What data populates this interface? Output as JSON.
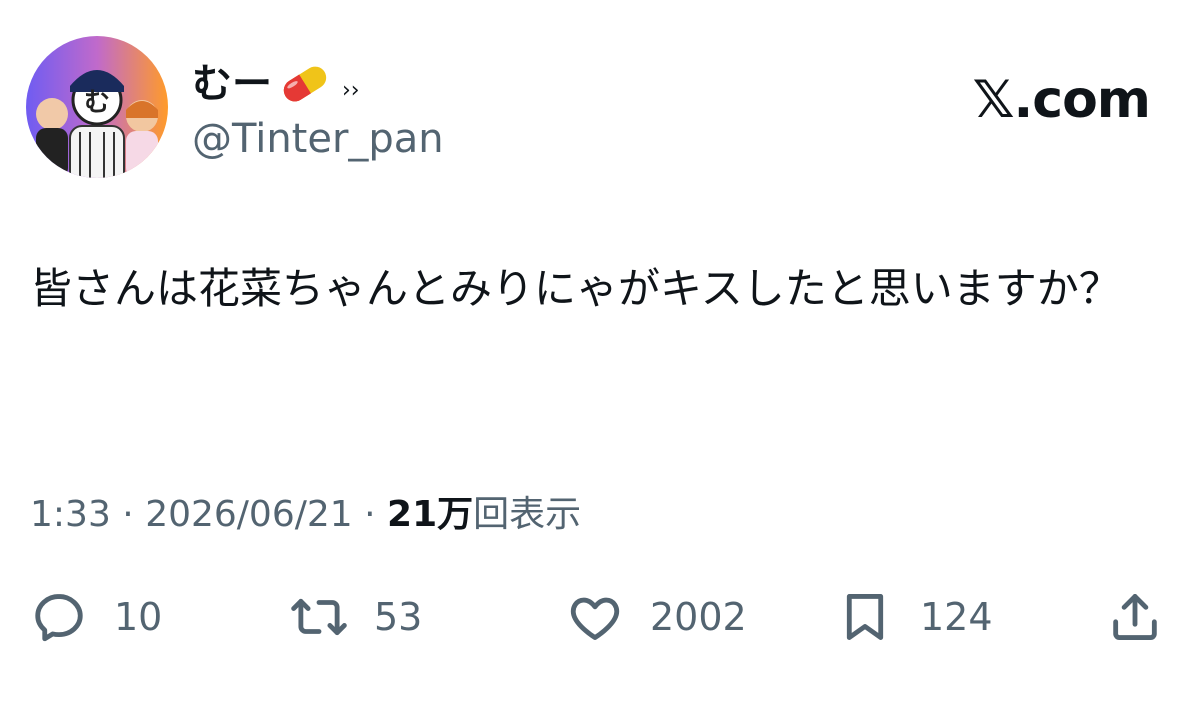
{
  "user": {
    "display_name": "むー",
    "name_suffix": "››",
    "handle": "@Tinter_pan",
    "avatar_glyph": "む"
  },
  "brand": "𝕏.com",
  "tweet": {
    "text": "皆さんは花菜ちゃんとみりにゃがキスしたと思いますか？"
  },
  "meta": {
    "time": "1:33",
    "date": "2026/06/21",
    "views_count": "21万",
    "views_label": "回表示"
  },
  "actions": {
    "replies": "10",
    "reposts": "53",
    "likes": "2002",
    "bookmarks": "124"
  },
  "colors": {
    "text": "#0f1419",
    "secondary": "#536471",
    "avatar_left": "#7b5cff",
    "avatar_right": "#ff9a1f"
  }
}
